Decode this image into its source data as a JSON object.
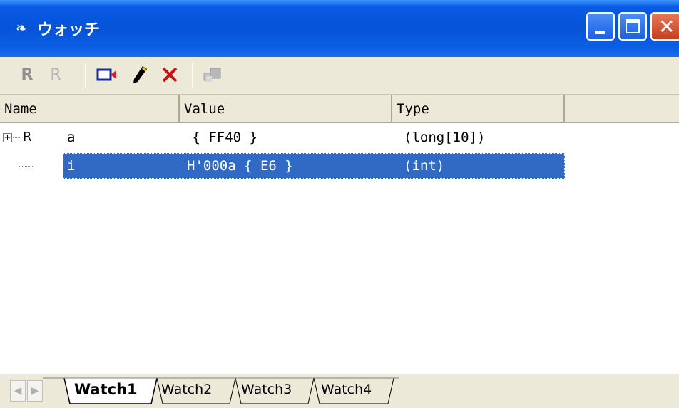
{
  "window": {
    "title": "ウォッチ",
    "title_icon": "watch-glasses-icon",
    "buttons": {
      "minimize": "minimize-icon",
      "maximize": "maximize-icon",
      "close": "close-icon"
    }
  },
  "toolbar": {
    "r1": "R",
    "r2": "R",
    "items": [
      "register-icon",
      "register-disabled-icon",
      "camera-icon",
      "pencil-icon",
      "delete-x-icon",
      "watch-add-icon"
    ]
  },
  "columns": {
    "name": "Name",
    "value": "Value",
    "type": "Type"
  },
  "rows": [
    {
      "expander": "+",
      "reg": "R",
      "name": "a",
      "value": " { FF40 }",
      "type": "(long[10])",
      "selected": false
    },
    {
      "expander": "",
      "reg": "",
      "name": "i",
      "value": "H'000a { E6 }",
      "type": "(int)",
      "selected": true
    }
  ],
  "tabs": [
    "Watch1",
    "Watch2",
    "Watch3",
    "Watch4"
  ],
  "active_tab": "Watch1",
  "colors": {
    "titlebar": "#0653d8",
    "selection": "#316ac5",
    "toolbar": "#ece9d8"
  }
}
